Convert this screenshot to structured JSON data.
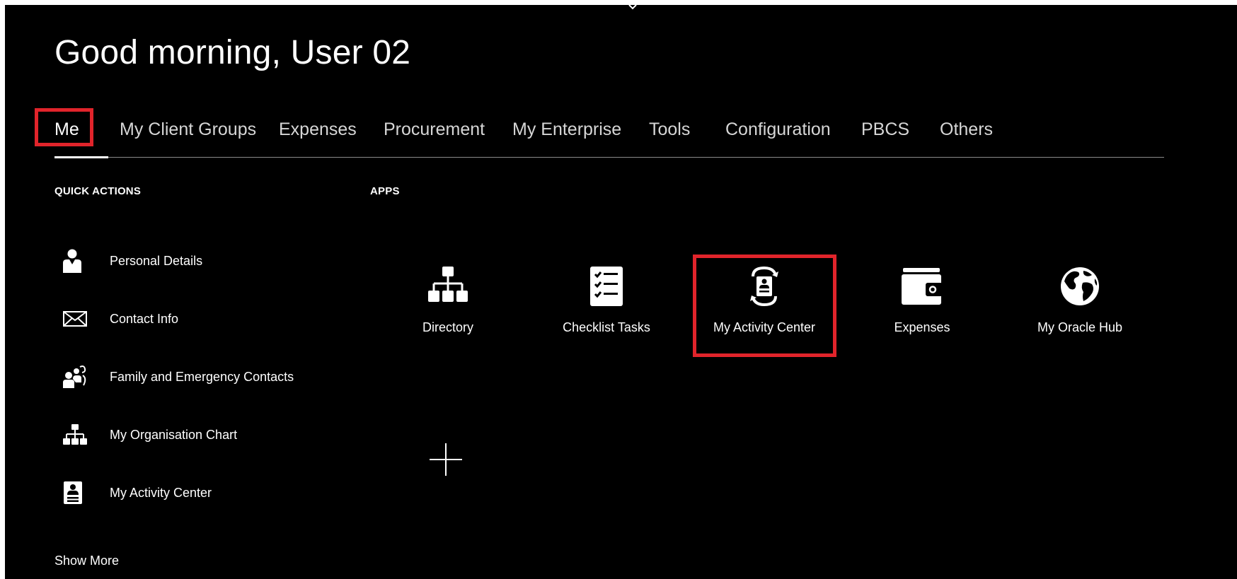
{
  "greeting": "Good morning, User 02",
  "nav": {
    "tabs": [
      {
        "label": "Me"
      },
      {
        "label": "My Client Groups"
      },
      {
        "label": "Expenses"
      },
      {
        "label": "Procurement"
      },
      {
        "label": "My Enterprise"
      },
      {
        "label": "Tools"
      },
      {
        "label": "Configuration"
      },
      {
        "label": "PBCS"
      },
      {
        "label": "Others"
      }
    ],
    "active_tab": "Me"
  },
  "quick_actions": {
    "title": "QUICK ACTIONS",
    "items": [
      {
        "label": "Personal Details",
        "icon": "person-icon"
      },
      {
        "label": "Contact Info",
        "icon": "envelope-icon"
      },
      {
        "label": "Family and Emergency Contacts",
        "icon": "family-contacts-icon"
      },
      {
        "label": "My Organisation Chart",
        "icon": "org-chart-icon"
      },
      {
        "label": "My Activity Center",
        "icon": "id-badge-icon"
      }
    ],
    "show_more": "Show More"
  },
  "apps": {
    "title": "APPS",
    "items": [
      {
        "label": "Directory",
        "icon": "org-chart-icon"
      },
      {
        "label": "Checklist Tasks",
        "icon": "checklist-icon"
      },
      {
        "label": "My Activity Center",
        "icon": "activity-center-icon"
      },
      {
        "label": "Expenses",
        "icon": "wallet-icon"
      },
      {
        "label": "My Oracle Hub",
        "icon": "globe-icon"
      }
    ],
    "add_icon": "plus-icon"
  },
  "colors": {
    "background": "#000000",
    "text": "#ffffff",
    "highlight": "#e1242b",
    "divider": "#8a8a8a"
  }
}
